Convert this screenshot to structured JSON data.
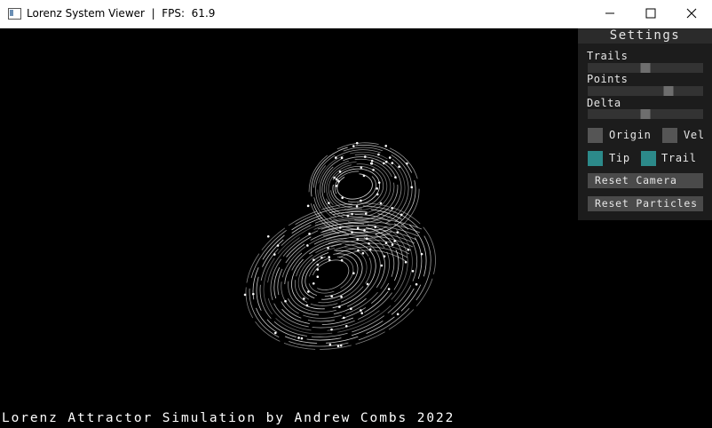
{
  "window": {
    "title": "Lorenz System Viewer  |  FPS:  61.9",
    "minimize_icon": "minimize-icon",
    "maximize_icon": "maximize-icon",
    "close_icon": "close-icon"
  },
  "settings": {
    "title": "Settings",
    "sliders": [
      {
        "label": "Trails",
        "value": 0.5
      },
      {
        "label": "Points",
        "value": 0.7
      },
      {
        "label": "Delta",
        "value": 0.5
      }
    ],
    "checkboxes": [
      {
        "label": "Origin",
        "checked": false
      },
      {
        "label": "Vel",
        "checked": false
      },
      {
        "label": "Tip",
        "checked": true
      },
      {
        "label": "Trail",
        "checked": true
      }
    ],
    "buttons": {
      "reset_camera": "Reset Camera",
      "reset_particles": "Reset Particles"
    }
  },
  "footer": {
    "credit": "Lorenz Attractor Simulation by Andrew Combs 2022"
  },
  "colors": {
    "accent_checked": "#2c8a8a",
    "unchecked": "#555555",
    "background": "#000000"
  }
}
